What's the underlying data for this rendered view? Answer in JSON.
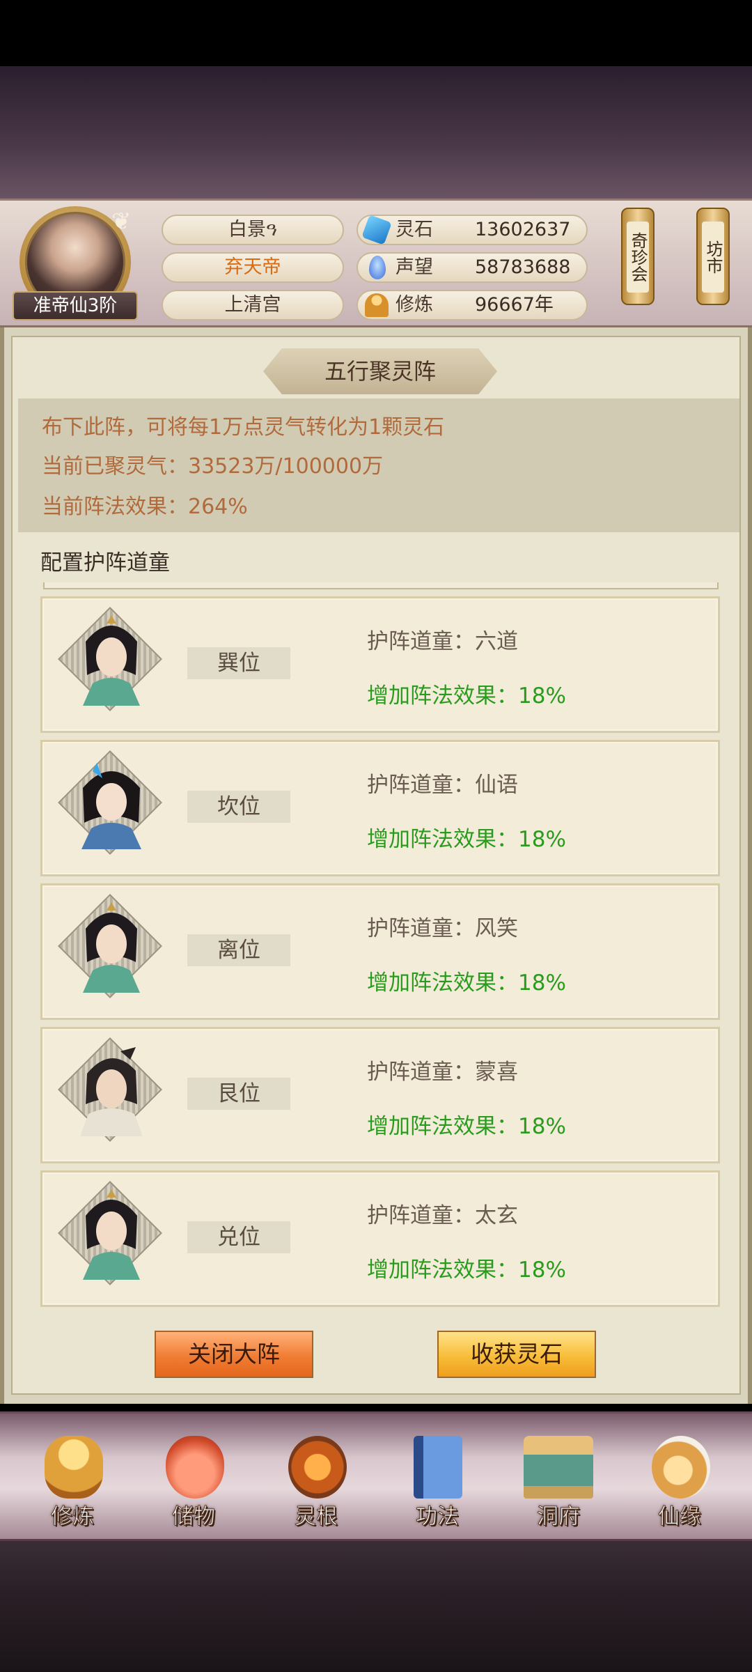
{
  "header": {
    "rank": "准帝仙3阶",
    "names": [
      "白景ዓ",
      "弃天帝",
      "上清宫"
    ],
    "resources": [
      {
        "label": "灵石",
        "value": "13602637",
        "icon": "spirit-stone-icon",
        "color": "#3aa0d8"
      },
      {
        "label": "声望",
        "value": "58783688",
        "icon": "prestige-crystal-icon",
        "color": "#5a8ad8"
      },
      {
        "label": "修炼",
        "value": "96667年",
        "icon": "meditation-icon",
        "color": "#d89a3a"
      }
    ],
    "scrolls": [
      "奇珍会",
      "坊市"
    ]
  },
  "panel": {
    "title": "五行聚灵阵",
    "info": [
      "布下此阵，可将每1万点灵气转化为1颗灵石",
      "当前已聚灵气：33523万/100000万",
      "当前阵法效果：264%"
    ],
    "section_label": "配置护阵道童",
    "guards": [
      {
        "position": "巽位",
        "name": "护阵道童：六道",
        "bonus": "增加阵法效果：18%"
      },
      {
        "position": "坎位",
        "name": "护阵道童：仙语",
        "bonus": "增加阵法效果：18%"
      },
      {
        "position": "离位",
        "name": "护阵道童：风笑",
        "bonus": "增加阵法效果：18%"
      },
      {
        "position": "艮位",
        "name": "护阵道童：蒙喜",
        "bonus": "增加阵法效果：18%"
      },
      {
        "position": "兑位",
        "name": "护阵道童：太玄",
        "bonus": "增加阵法效果：18%"
      }
    ],
    "buttons": {
      "close": "关闭大阵",
      "collect": "收获灵石"
    }
  },
  "bottom_nav": [
    {
      "label": "修炼",
      "icon": "cultivation-icon",
      "color": "#e0a03a"
    },
    {
      "label": "储物",
      "icon": "storage-bag-icon",
      "color": "#e06a4a"
    },
    {
      "label": "灵根",
      "icon": "spirit-root-icon",
      "color": "#c87a2a"
    },
    {
      "label": "功法",
      "icon": "technique-book-icon",
      "color": "#4a7ac8"
    },
    {
      "label": "洞府",
      "icon": "cave-dwelling-icon",
      "color": "#c8a05a"
    },
    {
      "label": "仙缘",
      "icon": "fortune-icon",
      "color": "#e0c07a"
    }
  ]
}
